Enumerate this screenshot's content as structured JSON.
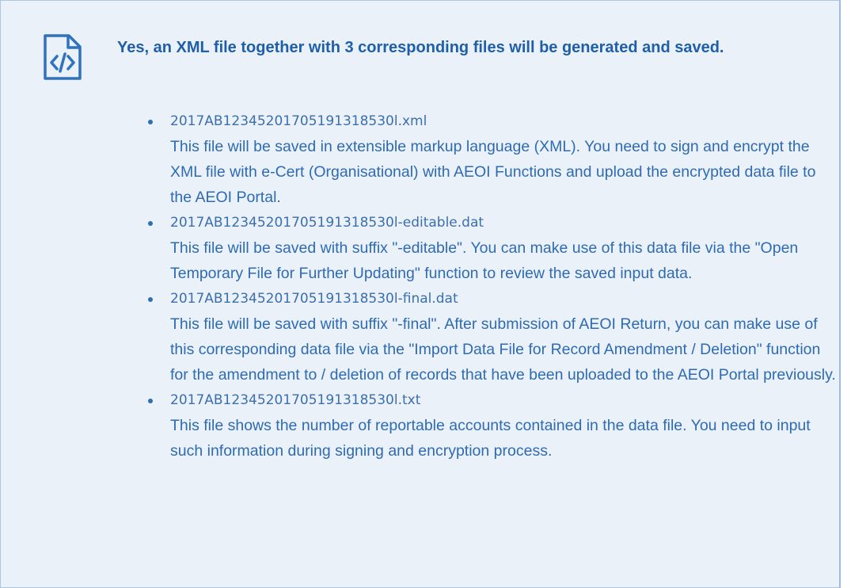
{
  "header": {
    "icon": "xml-file-icon",
    "message": "Yes, an XML file together with 3 corresponding files will be generated and saved."
  },
  "files": [
    {
      "name": "2017AB12345201705191318530l.xml",
      "description": "This file will be saved in extensible markup language (XML). You need to sign and encrypt the XML file with e-Cert (Organisational) with AEOI Functions and upload the encrypted data file to the AEOI Portal."
    },
    {
      "name": "2017AB12345201705191318530l-editable.dat",
      "description": "This file will be saved with suffix \"-editable\". You can make use of this data file via the \"Open Temporary File for Further Updating\" function to review the saved input data."
    },
    {
      "name": "2017AB12345201705191318530l-final.dat",
      "description": "This file will be saved with suffix \"-final\". After submission of AEOI Return, you can make use of this corresponding data file via the \"Import Data File for Record Amendment / Deletion\" function for the amendment to / deletion of records that have been uploaded to the AEOI Portal previously."
    },
    {
      "name": "2017AB12345201705191318530l.txt",
      "description": "This file shows the number of reportable accounts contained in the data file. You need to input such information during signing and encryption process."
    }
  ],
  "colors": {
    "panel_background": "#eaf1f8",
    "panel_border": "#a9c6e4",
    "accent": "#1f5fa9"
  }
}
